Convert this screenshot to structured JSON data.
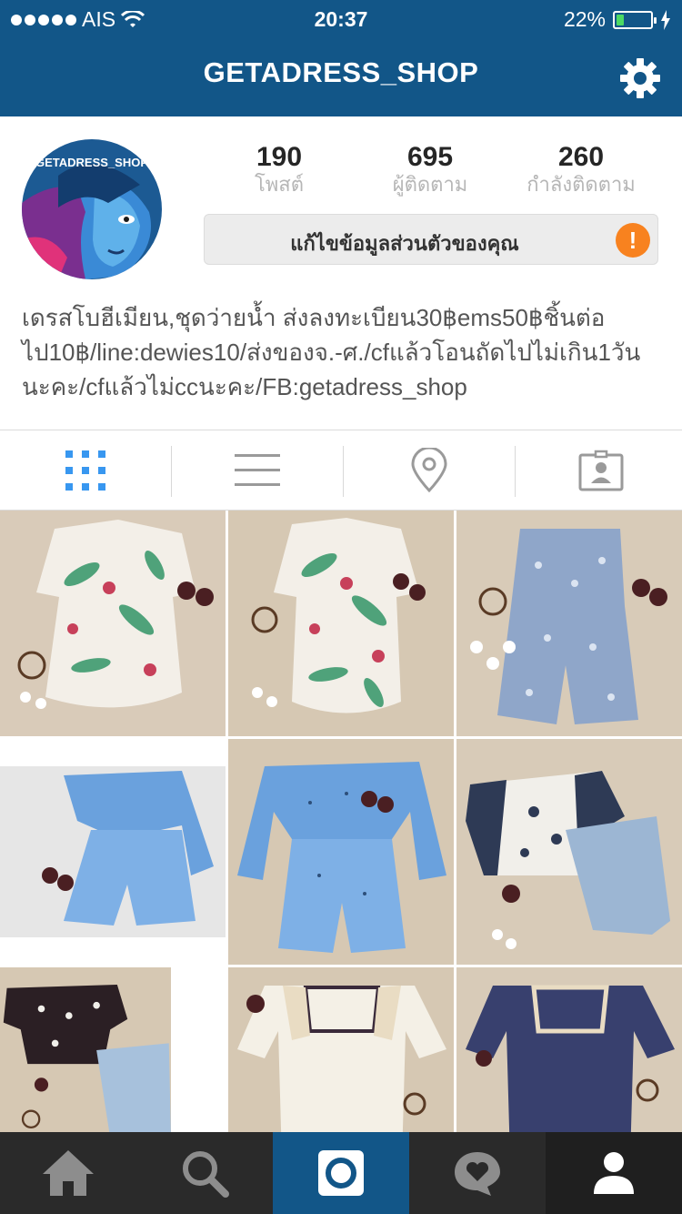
{
  "status_bar": {
    "carrier": "AIS",
    "time": "20:37",
    "battery_percent_text": "22%",
    "battery_level": 0.22
  },
  "header": {
    "title": "GETADRESS_SHOP",
    "settings_icon": "gear-icon"
  },
  "profile": {
    "avatar_text": "GETADRESS_SHOP",
    "stats": [
      {
        "value": "190",
        "label": "โพสต์"
      },
      {
        "value": "695",
        "label": "ผู้ติดตาม"
      },
      {
        "value": "260",
        "label": "กำลังติดตาม"
      }
    ],
    "edit_button_label": "แก้ไขข้อมูลส่วนตัวของคุณ",
    "warning_badge": "!",
    "bio": "เดรสโบฮีเมียน,ชุดว่ายน้ำ ส่งลงทะเบียน30฿ems50฿ชิ้นต่อไป10฿/line:dewies10/ส่งของจ.-ศ./cfแล้วโอนถัดไปไม่เกิน1วันนะคะ/cfแล้วไม่ccนะคะ/FB:getadress_shop"
  },
  "tabs": [
    {
      "icon": "grid-icon",
      "active": true
    },
    {
      "icon": "list-icon",
      "active": false
    },
    {
      "icon": "location-pin-icon",
      "active": false
    },
    {
      "icon": "tagged-photos-icon",
      "active": false
    }
  ],
  "bottom_nav": [
    {
      "icon": "home-icon"
    },
    {
      "icon": "search-icon"
    },
    {
      "icon": "camera-icon"
    },
    {
      "icon": "activity-heart-icon"
    },
    {
      "icon": "profile-icon"
    }
  ],
  "colors": {
    "header_blue": "#125688",
    "grid_active_blue": "#3897f0",
    "warning_orange": "#f8821f",
    "battery_green": "#4cd964"
  }
}
